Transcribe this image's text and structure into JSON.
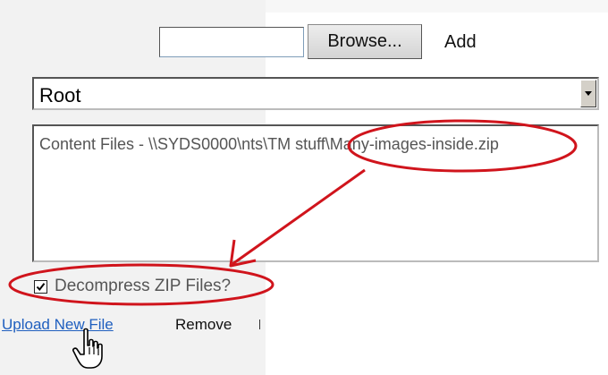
{
  "upload": {
    "file_input_value": "",
    "browse_label": "Browse...",
    "add_label": "Add"
  },
  "folder_select": {
    "selected": "Root"
  },
  "file_list": {
    "items": [
      "Content Files - \\\\SYDS0000\\nts\\TM stuff\\Many-images-inside.zip"
    ]
  },
  "options": {
    "decompress_label": "Decompress ZIP Files?",
    "decompress_checked": true
  },
  "actions": {
    "upload_label": "Upload New File",
    "remove_label": "Remove"
  },
  "annotation": {
    "color": "#d0141c"
  }
}
